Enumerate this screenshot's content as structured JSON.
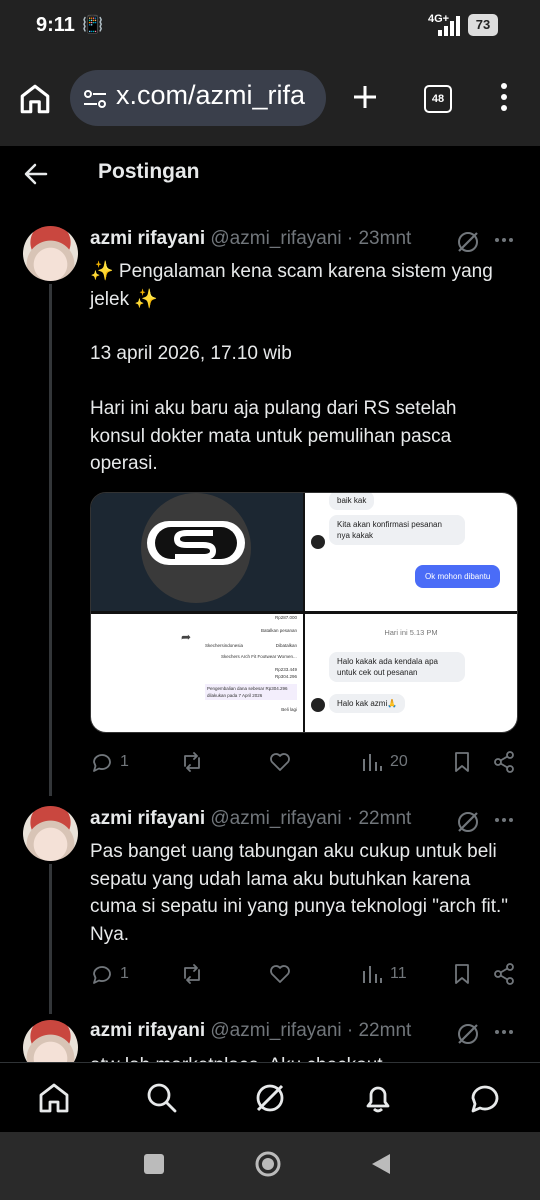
{
  "status_bar": {
    "time": "9:11",
    "network": "4G+",
    "battery": "73"
  },
  "browser": {
    "url": "x.com/azmi_rifa",
    "tab_count": "48"
  },
  "header": {
    "title": "Postingan"
  },
  "posts": [
    {
      "name": "azmi rifayani",
      "handle": "@azmi_rifayani · 23mnt",
      "lines": [
        "✨ Pengalaman kena scam karena sistem yang jelek ✨",
        "13 april 2026, 17.10 wib",
        "Hari ini aku baru aja pulang dari RS setelah konsul dokter mata untuk pemulihan pasca operasi."
      ],
      "replies": "1",
      "views": "20"
    },
    {
      "name": "azmi rifayani",
      "handle": "@azmi_rifayani · 22mnt",
      "lines": [
        "Pas banget uang tabungan aku cukup untuk beli sepatu yang udah lama aku butuhkan karena cuma si sepatu ini yang punya teknologi \"arch fit.\" Nya."
      ],
      "replies": "1",
      "views": "11"
    },
    {
      "name": "azmi rifayani",
      "handle": "@azmi_rifayani · 22mnt",
      "lines": [
        "atw lah marketplace. Aku checkout"
      ]
    }
  ],
  "media": {
    "chat_top": [
      "baik kak",
      "Kita akan konfirmasi pesanan nya kakak",
      "Ok mohon dibantu"
    ],
    "order": {
      "total1": "Rp287.000",
      "button": "Batalkan pesanan",
      "store": "Skechersindonesia",
      "status": "Dibatalkan",
      "item": "Skechers Arch Fit Footwear Women...",
      "price": "Rp233.449",
      "total2": "Rp304.296",
      "note": "Pengembalian dana sebesar Rp304.296 dilakukan pada 7 April 2026",
      "buy_again": "Beli lagi"
    },
    "chat_bottom": {
      "date": "Hari ini 5.13 PM",
      "msg1": "Halo kakak ada kendala apa untuk cek out pesanan",
      "msg2": "Halo kak azmi🙏"
    }
  },
  "colors": {
    "background": "#000000",
    "text": "#e7e9ea",
    "muted": "#71767b",
    "accent_blue": "#4a6cf7"
  }
}
